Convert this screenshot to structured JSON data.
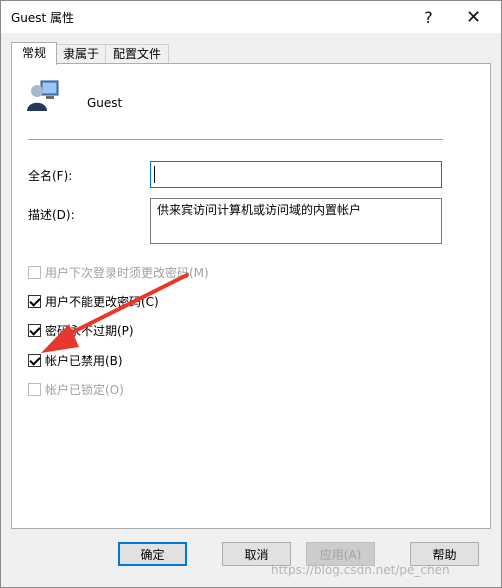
{
  "window": {
    "title": "Guest 属性",
    "help_label": "?",
    "close_label": "✕"
  },
  "tabs": [
    {
      "label": "常规",
      "active": true
    },
    {
      "label": "隶属于",
      "active": false
    },
    {
      "label": "配置文件",
      "active": false
    }
  ],
  "general": {
    "username": "Guest",
    "fullname_label": "全名(F):",
    "fullname_value": "",
    "description_label": "描述(D):",
    "description_value": "供来宾访问计算机或访问域的内置帐户"
  },
  "options": [
    {
      "label": "用户下次登录时须更改密码(M)",
      "checked": false,
      "disabled": true
    },
    {
      "label": "用户不能更改密码(C)",
      "checked": true,
      "disabled": false
    },
    {
      "label": "密码永不过期(P)",
      "checked": true,
      "disabled": false
    },
    {
      "label": "帐户已禁用(B)",
      "checked": true,
      "disabled": false
    },
    {
      "label": "帐户已锁定(O)",
      "checked": false,
      "disabled": true
    }
  ],
  "buttons": {
    "ok": "确定",
    "cancel": "取消",
    "apply": "应用(A)",
    "help": "帮助"
  },
  "annotation": {
    "arrow_color": "#e8372c"
  },
  "watermark": "https://blog.csdn.net/pe_chen"
}
